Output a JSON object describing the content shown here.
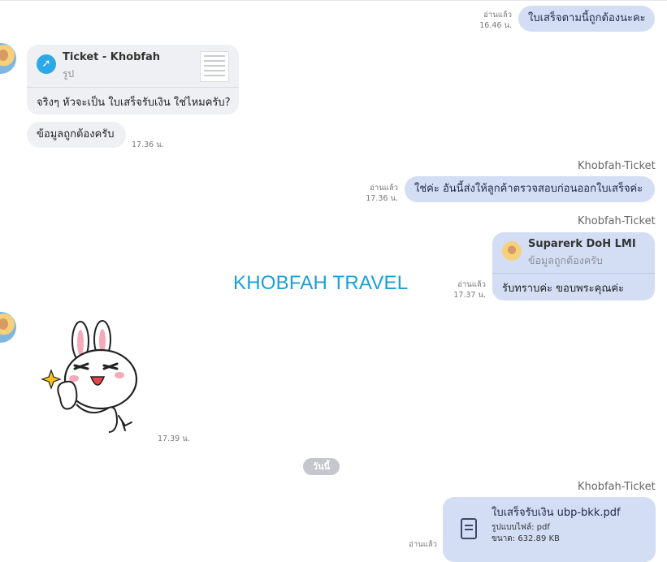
{
  "messages": {
    "m1": {
      "read": "อ่านแล้ว",
      "time": "16.46 น.",
      "text": "ใบเสร็จตามนี้ถูกต้องนะคะ"
    },
    "m2": {
      "card_title": "Ticket - Khobfah",
      "card_sub": "รูป",
      "text": "จริงๆ หัวจะเป็น ใบเสร็จรับเงิน ใช่ไหมครับ?"
    },
    "m3": {
      "text": "ข้อมูลถูกต้องครับ",
      "time": "17.36 น."
    },
    "m4": {
      "sender": "Khobfah-Ticket",
      "read": "อ่านแล้ว",
      "time": "17.36 น.",
      "text": "ใช่ค่ะ อันนี้ส่งให้ลูกค้าตรวจสอบก่อนออกใบเสร็จค่ะ"
    },
    "m5": {
      "sender": "Khobfah-Ticket",
      "quote_name": "Suparerk DoH LMI",
      "quote_text": "ข้อมูลถูกต้องครับ",
      "text": "รับทราบค่ะ ขอบพระคุณค่ะ",
      "read": "อ่านแล้ว",
      "time": "17.37 น."
    },
    "m6": {
      "time": "17.39 น."
    },
    "m7": {
      "sender": "Khobfah-Ticket",
      "file_name": "ใบเสร็จรับเงิน ubp-bkk.pdf",
      "file_type": "รูปแบบไฟล์: pdf",
      "file_size": "ขนาด: 632.89 KB",
      "read": "อ่านแล้ว"
    }
  },
  "watermark": "KHOBFAH TRAVEL",
  "date_separator": "วันนี้",
  "icons": {
    "file": "pdf-file-icon",
    "card": "paper-plane-icon"
  },
  "colors": {
    "outgoing": "#d3def5",
    "incoming": "#eef0f3",
    "brand": "#1aa0d8"
  }
}
